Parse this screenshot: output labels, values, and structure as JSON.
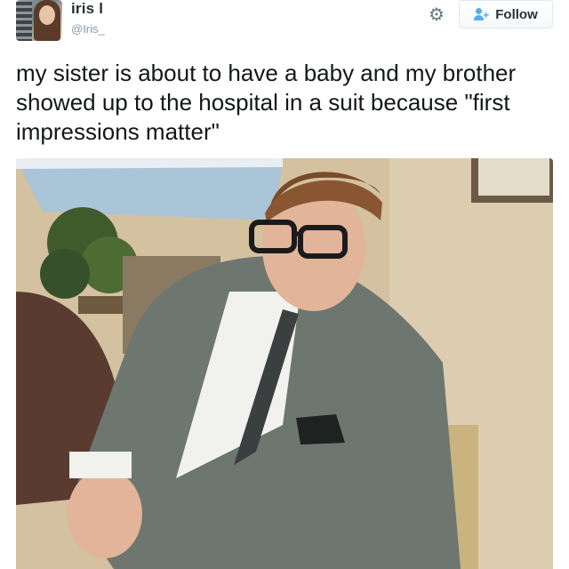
{
  "tweet": {
    "display_name": "iris l",
    "screen_name": "@Iris_",
    "text": "my sister is about to have a baby and my brother\nshowed up to the hospital in a suit because \"first\nimpressions matter\""
  },
  "actions": {
    "follow_label": "Follow",
    "follow_icon": "add-user-icon",
    "settings_icon": "gear-icon"
  },
  "media": {
    "photo_subject": "photo"
  },
  "colors": {
    "accent": "#55acee",
    "text_primary": "#14171a",
    "text_secondary": "#8899a6"
  }
}
